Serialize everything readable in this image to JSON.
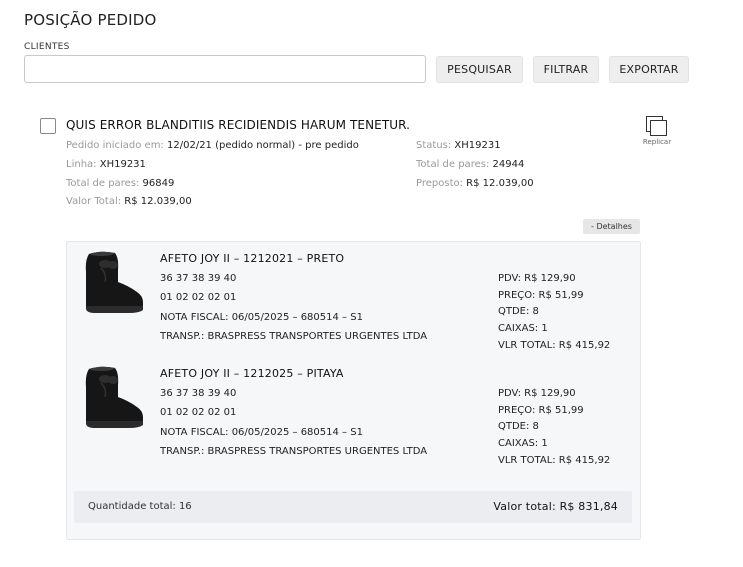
{
  "page": {
    "title": "POSIÇÃO PEDIDO"
  },
  "filters": {
    "clients_label": "CLIENTES",
    "clients_value": "",
    "search_label": "PESQUISAR",
    "filter_label": "FILTRAR",
    "export_label": "EXPORTAR"
  },
  "order": {
    "title": "QUIS ERROR BLANDITIIS RECIDIENDIS HARUM TENETUR.",
    "started_key": "Pedido iniciado em:",
    "started_value": "12/02/21 (pedido normal) - pre pedido",
    "line_key": "Linha:",
    "line_value": "XH19231",
    "total_pairs_left_key": "Total de pares:",
    "total_pairs_left_value": "96849",
    "total_value_key": "Valor Total:",
    "total_value_value": "R$ 12.039,00",
    "status_key": "Status:",
    "status_value": "XH19231",
    "total_pairs_right_key": "Total de pares:",
    "total_pairs_right_value": "24944",
    "preposto_key": "Preposto:",
    "preposto_value": "R$ 12.039,00",
    "replicate_label": "Replicar",
    "details_label": "- Detalhes",
    "items": [
      {
        "name": "AFETO JOY II – 1212021 – PRETO",
        "sizes": "36 37 38 39 40",
        "quantities": "01 02 02 02 01",
        "invoice": "NOTA FISCAL: 06/05/2025 – 680514 – S1",
        "carrier": "TRANSP.: BRASPRESS TRANSPORTES URGENTES LTDA",
        "pdv": "PDV: R$ 129,90",
        "price": "PREÇO: R$ 51,99",
        "qty": "QTDE: 8",
        "boxes": "CAIXAS: 1",
        "total": "VLR TOTAL: R$ 415,92",
        "image": "black-ankle-boot"
      },
      {
        "name": "AFETO JOY II – 1212025 – PITAYA",
        "sizes": "36 37 38 39 40",
        "quantities": "01 02 02 02 01",
        "invoice": "NOTA FISCAL: 06/05/2025 – 680514 – S1",
        "carrier": "TRANSP.: BRASPRESS TRANSPORTES URGENTES LTDA",
        "pdv": "PDV: R$ 129,90",
        "price": "PREÇO: R$ 51,99",
        "qty": "QTDE: 8",
        "boxes": "CAIXAS: 1",
        "total": "VLR TOTAL: R$ 415,92",
        "image": "black-ankle-boot"
      }
    ],
    "summary": {
      "quantity_total": "Quantidade total: 16",
      "value_total": "Valor total: R$ 831,84"
    }
  },
  "colors": {
    "muted": "#9a9a9a",
    "panel": "#f6f7f9",
    "button": "#eeeeee"
  }
}
